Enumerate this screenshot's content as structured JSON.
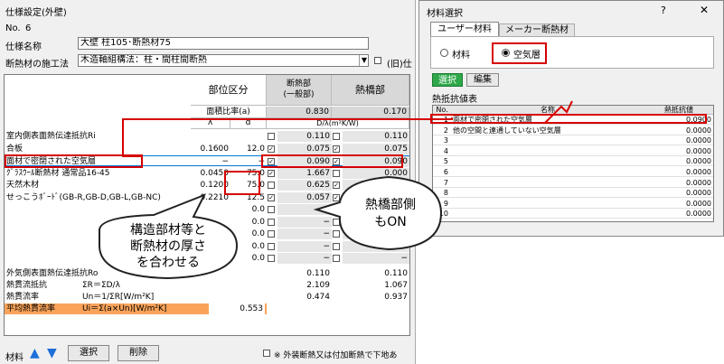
{
  "main": {
    "title": "仕様設定(外壁)",
    "no_label": "No.",
    "no_value": "6",
    "name_label": "仕様名称",
    "name_value": "大壁 柱105･断熱材75",
    "method_label": "断熱材の施工法",
    "method_value": "木造軸組構法：柱・間柱間断熱",
    "old_check_label": "(旧)仕"
  },
  "grid": {
    "part_header": "部位区分",
    "insul_header": "断熱部\n(一般部)",
    "bridge_header": "熱橋部",
    "area_label": "面積比率(a)",
    "area_insul": "0.830",
    "area_bridge": "0.170",
    "lambda": "λ",
    "d": "d",
    "dlambda": "D/λ(m²K/W)",
    "rows": [
      {
        "name": "室内側表面熱伝達抵抗Ri",
        "l": "",
        "d": "",
        "ci": "",
        "vi": "0.110",
        "cb": "",
        "vb": "0.110"
      },
      {
        "name": "合板",
        "l": "0.1600",
        "d": "12.0",
        "ci": "✓",
        "vi": "0.075",
        "cb": "✓",
        "vb": "0.075"
      },
      {
        "name": "面材で密閉された空気層",
        "l": "−",
        "d": "−",
        "ci": "✓",
        "vi": "0.090",
        "cb": "✓",
        "vb": "0.090"
      },
      {
        "name": "ｸﾞﾗｽｳｰﾙ断熱材 通常品16-45",
        "l": "0.0450",
        "d": "75.0",
        "ci": "✓",
        "vi": "1.667",
        "cb": "",
        "vb": "0.000"
      },
      {
        "name": "天然木材",
        "l": "0.1200",
        "d": "75.0",
        "ci": "",
        "vi": "0.625",
        "cb": "✓",
        "vb": "0.625"
      },
      {
        "name": "せっこうﾎﾞｰﾄﾞ(GB-R,GB-D,GB-L,GB-NC)",
        "l": "0.2210",
        "d": "12.5",
        "ci": "✓",
        "vi": "0.057",
        "cb": "✓",
        "vb": "0.057"
      },
      {
        "name": "",
        "l": "",
        "d": "0.0",
        "ci": "",
        "vi": "−",
        "cb": "",
        "vb": "−"
      },
      {
        "name": "",
        "l": "",
        "d": "0.0",
        "ci": "",
        "vi": "−",
        "cb": "",
        "vb": "−"
      },
      {
        "name": "",
        "l": "",
        "d": "0.0",
        "ci": "",
        "vi": "−",
        "cb": "",
        "vb": "−"
      },
      {
        "name": "",
        "l": "",
        "d": "0.0",
        "ci": "",
        "vi": "−",
        "cb": "",
        "vb": "−"
      },
      {
        "name": "",
        "l": "",
        "d": "0.0",
        "ci": "",
        "vi": "−",
        "cb": "",
        "vb": "−"
      }
    ],
    "outer_label": "外気側表面熱伝達抵抗Ro",
    "outer_i": "0.110",
    "outer_b": "0.110",
    "sumr_label": "熱貫流抵抗",
    "sumr_formula": "ΣR＝ΣD/λ",
    "sumr_i": "2.109",
    "sumr_b": "1.067",
    "u_label": "熱貫流率",
    "u_formula": "Un＝1/ΣR[W/m²K]",
    "u_i": "0.474",
    "u_b": "0.937",
    "avg_label": "平均熱貫流率",
    "avg_formula": "Ui＝Σ(a×Un)[W/m²K]",
    "avg_value": "0.553"
  },
  "footer": {
    "material_label": "材料",
    "up_icon": "▲",
    "down_icon": "▼",
    "select_btn": "選択",
    "delete_btn": "削除",
    "note": "※ 外装断熱又は付加断熱で下地あ"
  },
  "dialog": {
    "title": "材料選択",
    "help": "?",
    "close": "✕",
    "tab1": "ユーザー材料",
    "tab2": "メーカー断熱材",
    "radio1": "材料",
    "radio2": "空気層",
    "select_btn": "選択",
    "edit_btn": "編集",
    "table_label": "熱抵抗値表",
    "col_no": "No.",
    "col_name": "名称",
    "col_value": "熱抵抗値",
    "rows": [
      {
        "no": "1",
        "name": "面材で密閉された空気層",
        "value": "0.0900"
      },
      {
        "no": "2",
        "name": "他の空間と連通していない空気層",
        "value": "0.0000"
      },
      {
        "no": "3",
        "name": "",
        "value": "0.0000"
      },
      {
        "no": "4",
        "name": "",
        "value": "0.0000"
      },
      {
        "no": "5",
        "name": "",
        "value": "0.0000"
      },
      {
        "no": "6",
        "name": "",
        "value": "0.0000"
      },
      {
        "no": "7",
        "name": "",
        "value": "0.0000"
      },
      {
        "no": "8",
        "name": "",
        "value": "0.0000"
      },
      {
        "no": "9",
        "name": "",
        "value": "0.0000"
      },
      {
        "no": "10",
        "name": "",
        "value": "0.0000"
      }
    ]
  },
  "callouts": {
    "left": "構造部材等と\n断熱材の厚さ\nを合わせる",
    "right": "熱橋部側\nもON"
  },
  "colors": {
    "highlight": "#d50000",
    "select_green": "#2ea84a",
    "avg_orange": "#f9a35a",
    "row_blue": "#0078d7"
  }
}
